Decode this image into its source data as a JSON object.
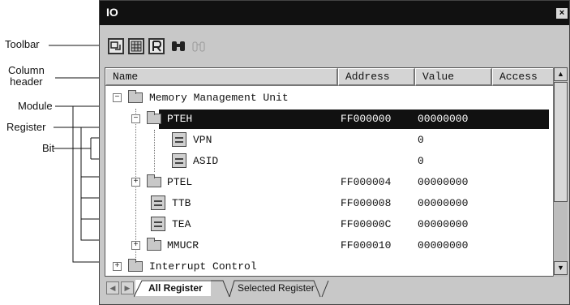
{
  "callouts": {
    "toolbar": "Toolbar",
    "column_header_line1": "Column",
    "column_header_line2": "header",
    "module": "Module",
    "register": "Register",
    "bit": "Bit"
  },
  "window": {
    "title": "IO",
    "close_glyph": "×"
  },
  "toolbar": {
    "buttons": [
      "refresh-icon",
      "grid-icon",
      "register-icon",
      "binoculars-icon",
      "binoculars-disabled-icon"
    ]
  },
  "columns": {
    "name": "Name",
    "address": "Address",
    "value": "Value",
    "access": "Access"
  },
  "rows": [
    {
      "expander": "−",
      "name": "Memory Management Unit",
      "address": "",
      "value": ""
    },
    {
      "expander": "−",
      "name": "PTEH",
      "address": "FF000000",
      "value": "00000000"
    },
    {
      "expander": "",
      "name": "VPN",
      "address": "",
      "value": "0"
    },
    {
      "expander": "",
      "name": "ASID",
      "address": "",
      "value": "0"
    },
    {
      "expander": "+",
      "name": "PTEL",
      "address": "FF000004",
      "value": "00000000"
    },
    {
      "expander": "",
      "name": "TTB",
      "address": "FF000008",
      "value": "00000000"
    },
    {
      "expander": "",
      "name": "TEA",
      "address": "FF00000C",
      "value": "00000000"
    },
    {
      "expander": "+",
      "name": "MMUCR",
      "address": "FF000010",
      "value": "00000000"
    },
    {
      "expander": "+",
      "name": "Interrupt Control",
      "address": "",
      "value": ""
    }
  ],
  "tabs": {
    "active": "All Register",
    "inactive": "Selected Register"
  },
  "scroll": {
    "up_glyph": "▲",
    "down_glyph": "▼",
    "left_glyph": "◀",
    "right_glyph": "▶"
  }
}
